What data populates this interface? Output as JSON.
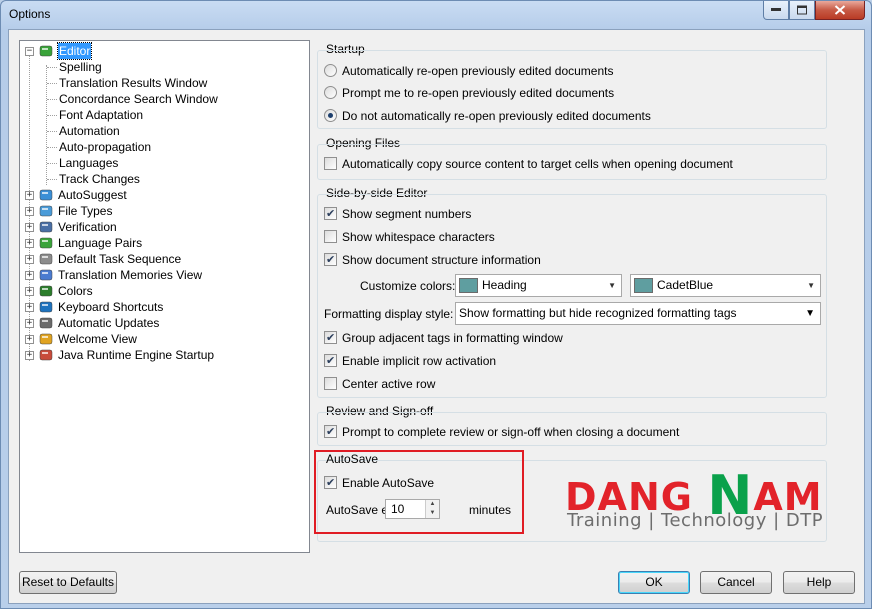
{
  "window": {
    "title": "Options"
  },
  "tree": {
    "items": [
      {
        "label": "Editor",
        "selected": true,
        "expanded": true,
        "icon": "pencil-icon",
        "level": 0
      },
      {
        "label": "Spelling",
        "level": 1
      },
      {
        "label": "Translation Results Window",
        "level": 1
      },
      {
        "label": "Concordance Search Window",
        "level": 1
      },
      {
        "label": "Font Adaptation",
        "level": 1
      },
      {
        "label": "Automation",
        "level": 1
      },
      {
        "label": "Auto-propagation",
        "level": 1
      },
      {
        "label": "Languages",
        "level": 1
      },
      {
        "label": "Track Changes",
        "level": 1
      },
      {
        "label": "AutoSuggest",
        "level": 0,
        "icon": "autosuggest-icon"
      },
      {
        "label": "File Types",
        "level": 0,
        "icon": "file-types-icon"
      },
      {
        "label": "Verification",
        "level": 0,
        "icon": "verification-icon"
      },
      {
        "label": "Language Pairs",
        "level": 0,
        "icon": "language-pairs-icon"
      },
      {
        "label": "Default Task Sequence",
        "level": 0,
        "icon": "task-sequence-icon"
      },
      {
        "label": "Translation Memories View",
        "level": 0,
        "icon": "tm-view-icon"
      },
      {
        "label": "Colors",
        "level": 0,
        "icon": "colors-icon"
      },
      {
        "label": "Keyboard Shortcuts",
        "level": 0,
        "icon": "keyboard-icon"
      },
      {
        "label": "Automatic Updates",
        "level": 0,
        "icon": "updates-icon"
      },
      {
        "label": "Welcome View",
        "level": 0,
        "icon": "welcome-icon"
      },
      {
        "label": "Java Runtime Engine Startup",
        "level": 0,
        "icon": "java-icon"
      }
    ]
  },
  "startup": {
    "title": "Startup",
    "options": [
      {
        "label": "Automatically re-open previously edited documents",
        "checked": false
      },
      {
        "label": "Prompt me to re-open previously edited documents",
        "checked": false
      },
      {
        "label": "Do not automatically re-open previously edited documents",
        "checked": true
      }
    ]
  },
  "opening": {
    "title": "Opening Files",
    "copy_source": {
      "label": "Automatically copy source content to target cells when opening document",
      "checked": false
    }
  },
  "sbs": {
    "title": "Side-by-side Editor",
    "segment_numbers": {
      "label": "Show segment numbers",
      "checked": true
    },
    "whitespace": {
      "label": "Show whitespace characters",
      "checked": false
    },
    "doc_structure": {
      "label": "Show document structure information",
      "checked": true
    },
    "customize_label": "Customize colors:",
    "color_target": "Heading",
    "color_target_swatch": "#5f9ea0",
    "color_value": "CadetBlue",
    "color_value_swatch": "#5f9ea0",
    "format_label": "Formatting display style:",
    "format_value": "Show formatting but hide recognized formatting tags",
    "group_tags": {
      "label": "Group adjacent tags in formatting window",
      "checked": true
    },
    "implicit_row": {
      "label": "Enable implicit row activation",
      "checked": true
    },
    "center_row": {
      "label": "Center active row",
      "checked": false
    }
  },
  "review": {
    "title": "Review and Sign-off",
    "prompt": {
      "label": "Prompt to complete review or sign-off when closing a document",
      "checked": true
    }
  },
  "autosave": {
    "title": "AutoSave",
    "enable": {
      "label": "Enable AutoSave",
      "checked": true
    },
    "every_label": "AutoSave every",
    "minutes_value": "10",
    "minutes_label": "minutes"
  },
  "logo": {
    "brand_a": "DANG ",
    "brand_n": "N",
    "brand_b": "AM",
    "tagline": "Training | Technology | DTP",
    "red": "#e2232a",
    "green": "#0aa14b"
  },
  "buttons": {
    "reset": "Reset to Defaults",
    "ok": "OK",
    "cancel": "Cancel",
    "help": "Help"
  }
}
